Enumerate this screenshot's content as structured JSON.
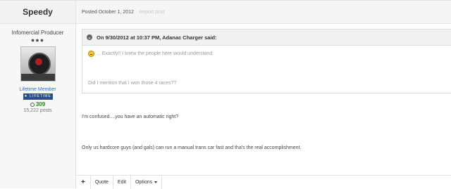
{
  "author": {
    "username": "Speedy",
    "title": "Infomercial Producer",
    "rank_dots": "●●●",
    "member_group": "Lifetime Member",
    "badge_text": "LIFETIME",
    "reputation": "309",
    "post_count": "15,222 posts"
  },
  "post_header": {
    "posted": "Posted October 1, 2012",
    "report": "· Report post"
  },
  "quote": {
    "header": "On 9/30/2012 at 10:37 PM, Adanac Charger said:",
    "line1": "... Exactly!! I knew the people here would understand.",
    "line2": "Did I mention that I won those 4 races??"
  },
  "body": {
    "line1": "I'm confused....you have an automatic right?",
    "line2": "Only us hardcore guys (and gals) can run a manual trans car fast and tha's the real accomplishment."
  },
  "actions": {
    "plus": "+",
    "quote": "Quote",
    "edit": "Edit",
    "options": "Options"
  },
  "colors": {
    "link": "#3a6fb7",
    "reputation": "#2d7a2d",
    "badge": "#2d4f86"
  }
}
